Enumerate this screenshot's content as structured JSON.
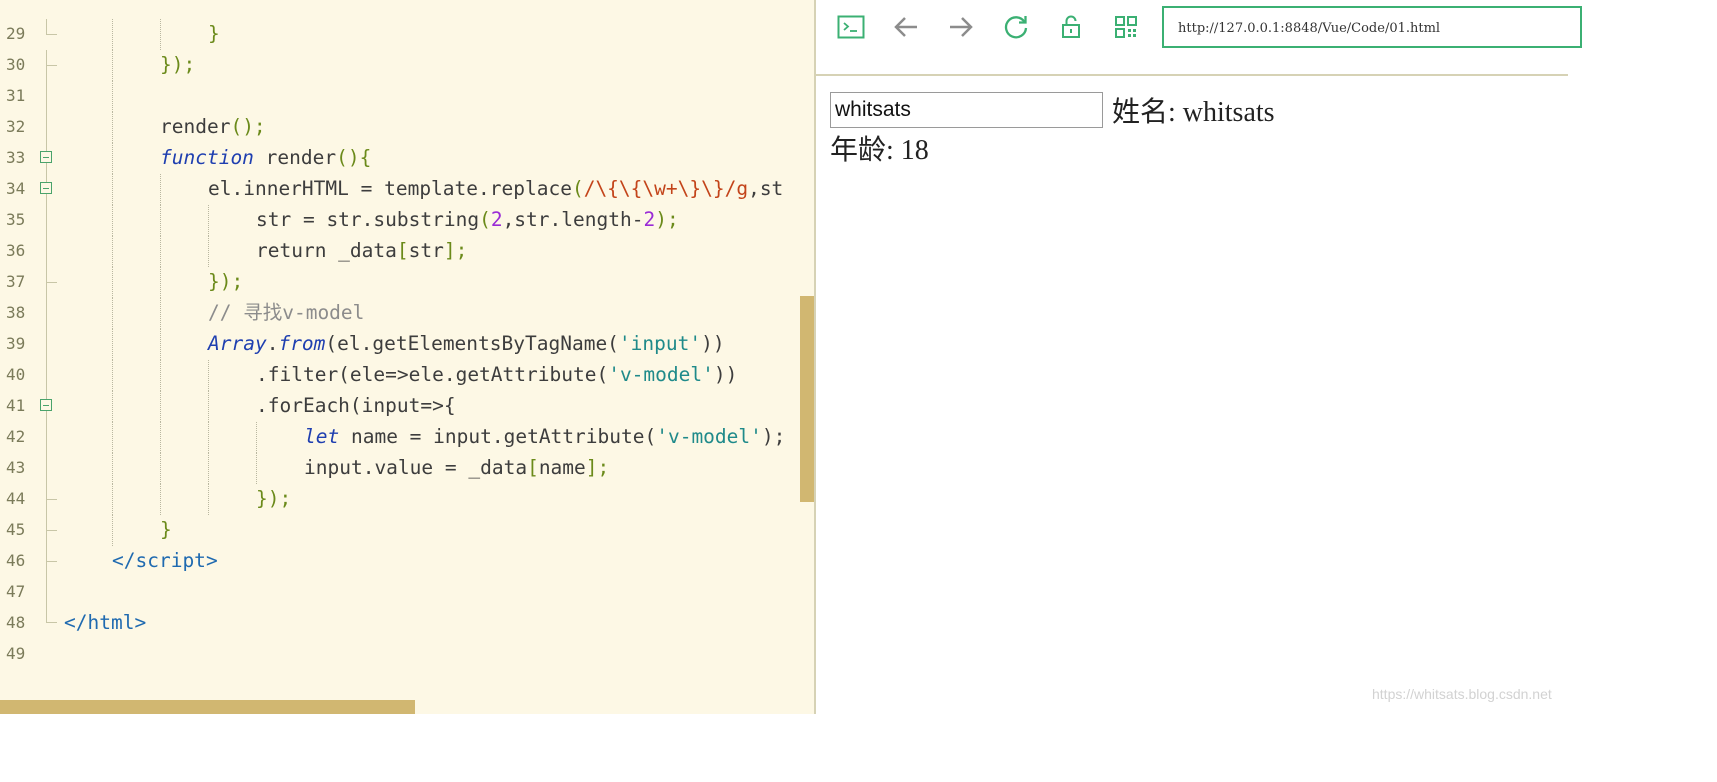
{
  "editor": {
    "line_numbers": [
      "29",
      "30",
      "31",
      "32",
      "33",
      "34",
      "35",
      "36",
      "37",
      "38",
      "39",
      "40",
      "41",
      "42",
      "43",
      "44",
      "45",
      "46",
      "47",
      "48",
      "49"
    ],
    "code": {
      "l29_close": "}",
      "l30_close": "});",
      "l32_a": "render",
      "l32_b": "();",
      "l33_kw": "function",
      "l33_a": " render",
      "l33_b": "(){",
      "l34_a": "el.innerHTML = template.replace",
      "l34_b": "(",
      "l34_re": "/\\{\\{\\w+\\}\\}/g",
      "l34_c": ",st",
      "l35_a": "str = str.substring",
      "l35_b": "(",
      "l35_n1": "2",
      "l35_c": ",str.length-",
      "l35_n2": "2",
      "l35_d": ");",
      "l36_a": "return _data",
      "l36_b": "[",
      "l36_c": "str",
      "l36_d": "];",
      "l37": "});",
      "l38_comment": "// 寻找v-model",
      "l39_kw1": "Array",
      "l39_dot": ".",
      "l39_kw2": "from",
      "l39_a": "(el.getElementsByTagName(",
      "l39_str": "'input'",
      "l39_b": "))",
      "l40_a": ".filter(ele=>ele.getAttribute(",
      "l40_str": "'v-model'",
      "l40_b": "))",
      "l41_a": ".forEach(input=>{",
      "l42_kw": "let",
      "l42_a": " name = input.getAttribute(",
      "l42_str": "'v-model'",
      "l42_b": ");",
      "l43_a": "input.value = _data",
      "l43_b": "[",
      "l43_c": "name",
      "l43_d": "];",
      "l44": "});",
      "l45": "}",
      "l46_a": "</",
      "l46_b": "script",
      "l46_c": ">",
      "l48_a": "</",
      "l48_b": "html",
      "l48_c": ">"
    }
  },
  "browser": {
    "toolbar": {
      "icons": [
        "terminal-icon",
        "back-arrow-icon",
        "forward-arrow-icon",
        "refresh-icon",
        "unlock-icon",
        "qr-code-icon"
      ]
    },
    "url": "http://127.0.0.1:8848/Vue/Code/01.html",
    "page": {
      "input_value": "whitsats",
      "name_label": "姓名: whitsats",
      "age_label": "年龄: 18"
    },
    "watermark": "https://whitsats.blog.csdn.net"
  },
  "colors": {
    "editor_bg": "#fdf8e5",
    "accent_green": "#3bb073",
    "scrollbar": "#d1b771"
  }
}
